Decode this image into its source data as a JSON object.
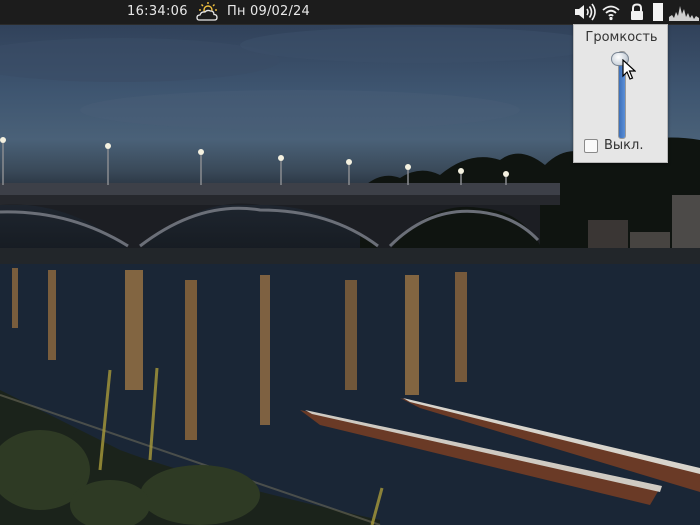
{
  "panel": {
    "clock": "16:34:06",
    "date": "Пн 09/02/24",
    "weather_icon": "partly-cloudy-icon",
    "tray_icons": [
      "volume-icon",
      "wifi-icon",
      "lock-icon",
      "battery-icon",
      "system-monitor-icon"
    ]
  },
  "volume_popup": {
    "title": "Громкость",
    "level": 0.95,
    "mute_label": "Выкл.",
    "muted": false
  },
  "colors": {
    "panel_bg": "#1c1c1c",
    "popup_bg": "#e6e6e6",
    "slider_fill": "#4a7fc8"
  }
}
